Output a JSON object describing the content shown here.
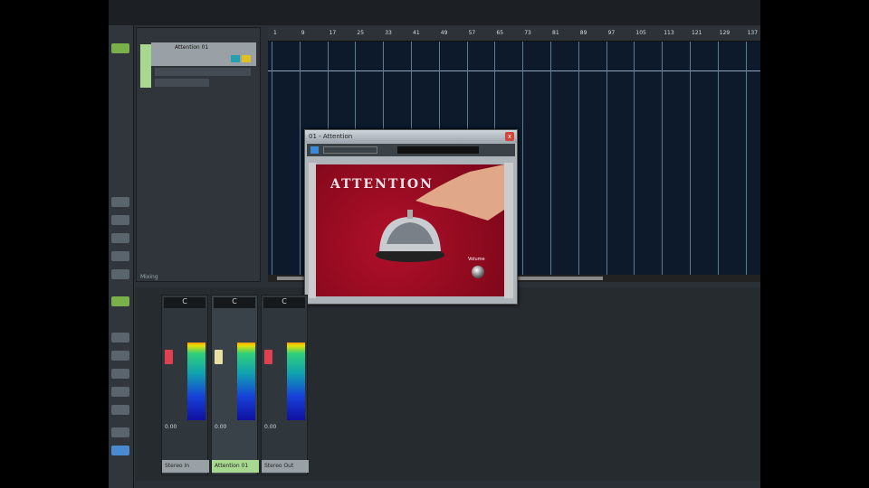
{
  "track": {
    "name": "Attention 01"
  },
  "tracklist_footer": "Mixing",
  "ruler": [
    "1",
    "9",
    "17",
    "25",
    "33",
    "41",
    "49",
    "57",
    "65",
    "73",
    "81",
    "89",
    "97",
    "105",
    "113",
    "121",
    "129",
    "137"
  ],
  "plugin": {
    "title": "01 - Attention",
    "brand": "ATTENTION",
    "volume_label": "Volume",
    "close": "x"
  },
  "mixer": {
    "channels": [
      {
        "name": "Stereo In",
        "value": "0.00",
        "pan": "C",
        "fader_color": "#e04050",
        "selected": false
      },
      {
        "name": "Attention 01",
        "value": "0.00",
        "pan": "C",
        "fader_color": "#e8e0a0",
        "selected": true
      },
      {
        "name": "Stereo Out",
        "value": "0.00",
        "pan": "C",
        "fader_color": "#e04050",
        "selected": false
      }
    ]
  }
}
